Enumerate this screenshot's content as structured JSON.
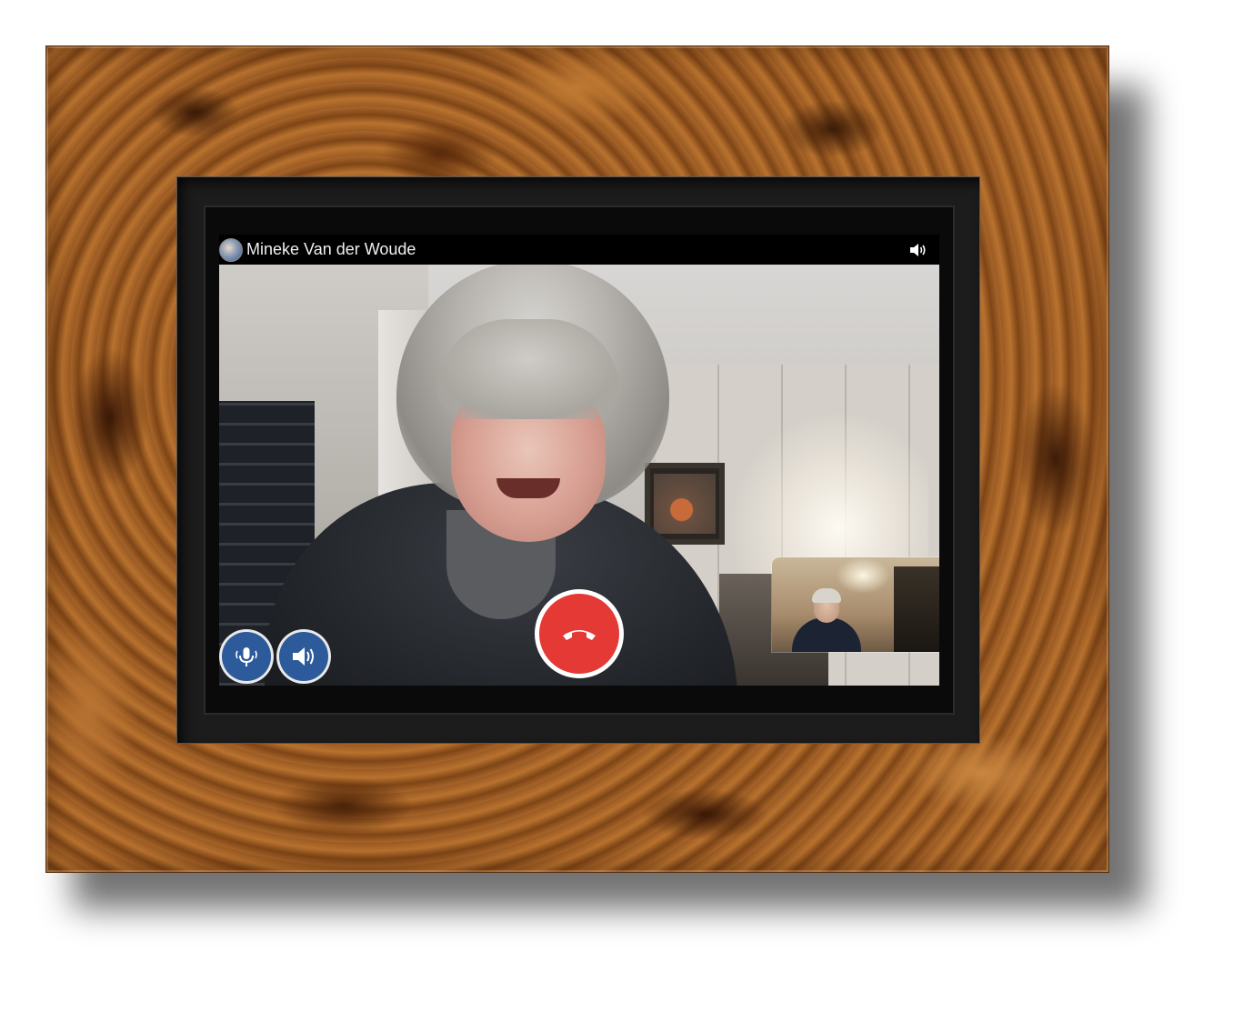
{
  "call": {
    "caller_name": "Mineke Van der Woude"
  },
  "icons": {
    "avatar": "avatar-icon",
    "speaker_status": "speaker-icon",
    "microphone": "microphone-icon",
    "speaker": "speaker-icon",
    "hangup": "phone-hangup-icon"
  },
  "colors": {
    "hangup": "#e53935",
    "control": "#2d5a9a",
    "topbar": "#000000",
    "frame_wood": "#a0602a"
  }
}
